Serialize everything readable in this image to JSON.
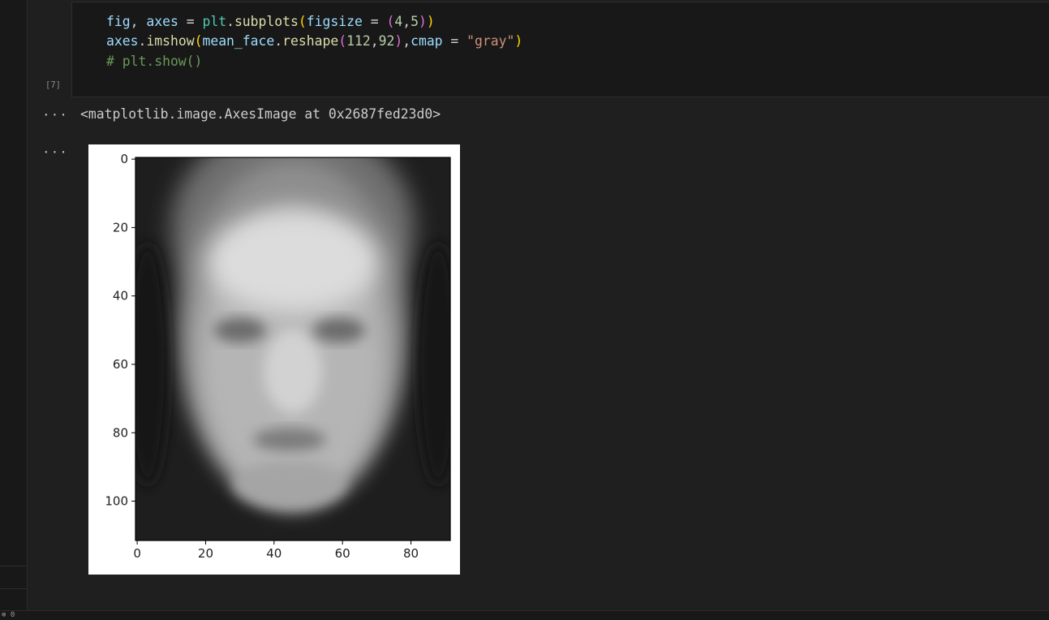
{
  "cell": {
    "exec_count": "[7]",
    "code": [
      [
        [
          "fig",
          "var"
        ],
        [
          ", ",
          "op"
        ],
        [
          "axes",
          "var"
        ],
        [
          " = ",
          "op"
        ],
        [
          "plt",
          "mod"
        ],
        [
          ".",
          "op"
        ],
        [
          "subplots",
          "fn"
        ],
        [
          "(",
          "p1"
        ],
        [
          "figsize",
          "var"
        ],
        [
          " = ",
          "op"
        ],
        [
          "(",
          "p2"
        ],
        [
          "4",
          "num"
        ],
        [
          ",",
          "op"
        ],
        [
          "5",
          "num"
        ],
        [
          ")",
          "p2"
        ],
        [
          ")",
          "p1"
        ]
      ],
      [
        [
          "axes",
          "var"
        ],
        [
          ".",
          "op"
        ],
        [
          "imshow",
          "fn"
        ],
        [
          "(",
          "p1"
        ],
        [
          "mean_face",
          "var"
        ],
        [
          ".",
          "op"
        ],
        [
          "reshape",
          "fn"
        ],
        [
          "(",
          "p2"
        ],
        [
          "112",
          "num"
        ],
        [
          ",",
          "op"
        ],
        [
          "92",
          "num"
        ],
        [
          ")",
          "p2"
        ],
        [
          ",",
          "op"
        ],
        [
          "cmap",
          "var"
        ],
        [
          " = ",
          "op"
        ],
        [
          "\"gray\"",
          "str"
        ],
        [
          ")",
          "p1"
        ]
      ],
      [
        [
          "# plt.show()",
          "cm"
        ]
      ]
    ]
  },
  "output": {
    "more_label": "···",
    "text": "<matplotlib.image.AxesImage at 0x2687fed23d0>"
  },
  "figure": {
    "description": "Grayscale image of an averaged (mean) face",
    "x_ticks": [
      0,
      20,
      40,
      60,
      80
    ],
    "y_ticks": [
      0,
      20,
      40,
      60,
      80,
      100
    ],
    "x_range": [
      -0.5,
      91.5
    ],
    "y_range": [
      -0.5,
      111.5
    ],
    "image_shape": [
      112,
      92
    ],
    "cmap": "gray"
  },
  "status": {
    "text": "⊗ 0"
  }
}
